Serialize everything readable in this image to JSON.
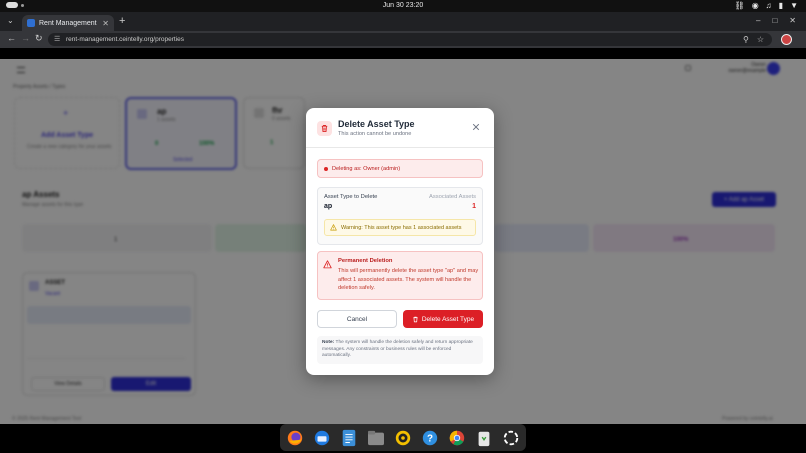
{
  "os": {
    "clock": "Jun 30  23:20"
  },
  "browser": {
    "tab_title": "Rent Management Tool",
    "url": "rent-management.ceintelly.org/properties"
  },
  "modal": {
    "title": "Delete Asset Type",
    "subtitle": "This action cannot be undone",
    "deleting_as": "Deleting as: Owner (admin)",
    "asset_type_label": "Asset Type to Delete",
    "asset_type_value": "ap",
    "associated_label": "Associated Assets",
    "associated_count": "1",
    "warning": "Warning: This asset type has 1 associated assets",
    "permanent_title": "Permanent Deletion",
    "permanent_body": "This will permanently delete the asset type \"ap\" and may affect 1 associated assets. The system will handle the deletion safely.",
    "cancel_label": "Cancel",
    "delete_label": "Delete Asset Type",
    "note_label": "Note:",
    "note_text": " The system will handle the deletion safely and return appropriate messages. Any constraints or business rules will be enforced automatically."
  },
  "background_page": {
    "breadcrumb": "Property Assets  /  Types",
    "add_asset_type_title": "Add Asset Type",
    "add_asset_type_desc": "Create a new category for your assets",
    "type_ap_name": "ap",
    "type_ap_sub": "1 assets",
    "type_ap_count": "0",
    "type_ap_pct": "100%",
    "type_ap_select": "Selected",
    "type_2_name": "fhr",
    "type_2_sub": "0 assets",
    "type_2_count": "1",
    "section_title": "ap Assets",
    "section_sub": "Manage assets for this type",
    "add_asset_button": "+ Add ap Asset",
    "stat_total": "1",
    "stat_pct": "100%",
    "asset_card_title": "ASSET",
    "asset_card_status": "Vacant",
    "view_details": "View Details",
    "edit": "Edit",
    "footer_left": "© 2025 Rent Management Tool",
    "footer_right": "Powered by ceintelly.ai"
  },
  "colors": {
    "danger": "#dc1f26",
    "accent": "#4f46e5"
  },
  "dock": {
    "items": [
      "firefox-icon",
      "thunderbird-icon",
      "text-editor-icon",
      "files-icon",
      "rhythmbox-icon",
      "help-icon",
      "chrome-icon",
      "trash-icon",
      "apps-grid-icon"
    ]
  }
}
